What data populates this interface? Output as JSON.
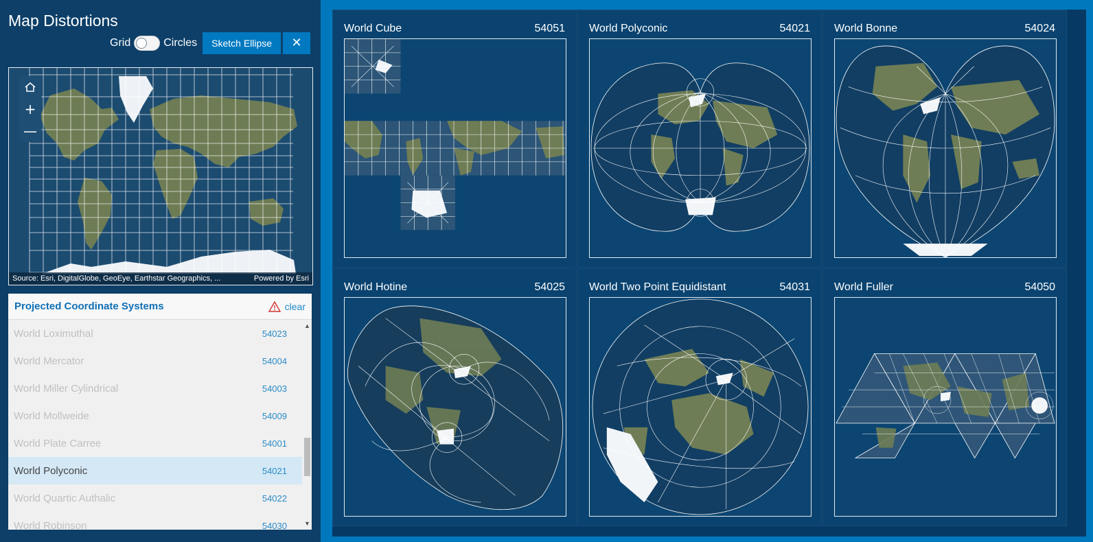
{
  "app": {
    "title": "Map Distortions"
  },
  "controls": {
    "grid_label": "Grid",
    "circles_label": "Circles",
    "sketch_label": "Sketch Ellipse",
    "close_label": "✕"
  },
  "overview_map": {
    "attribution": "Source: Esri, DigitalGlobe, GeoEye, Earthstar Geographics, ...",
    "powered_by": "Powered by Esri",
    "zoom_in": "+",
    "zoom_out": "—"
  },
  "pcs_panel": {
    "title": "Projected Coordinate Systems",
    "clear_label": "clear",
    "items": [
      {
        "name": "World Loximuthal",
        "code": "54023"
      },
      {
        "name": "World Mercator",
        "code": "54004"
      },
      {
        "name": "World Miller Cylindrical",
        "code": "54003"
      },
      {
        "name": "World Mollweide",
        "code": "54009"
      },
      {
        "name": "World Plate Carree",
        "code": "54001"
      },
      {
        "name": "World Polyconic",
        "code": "54021",
        "selected": true
      },
      {
        "name": "World Quartic Authalic",
        "code": "54022"
      },
      {
        "name": "World Robinson",
        "code": "54030"
      }
    ]
  },
  "projections": [
    {
      "name": "World Cube",
      "code": "54051"
    },
    {
      "name": "World Polyconic",
      "code": "54021"
    },
    {
      "name": "World Bonne",
      "code": "54024"
    },
    {
      "name": "World Hotine",
      "code": "54025"
    },
    {
      "name": "World Two Point Equidistant",
      "code": "54031"
    },
    {
      "name": "World Fuller",
      "code": "54050"
    }
  ],
  "colors": {
    "accent": "#0079c1",
    "panel_bg": "#0d3f68",
    "ocean": "#113d62",
    "land": "#6e7d55",
    "ice": "#f2f5f8",
    "grid_line": "#ffffff"
  }
}
